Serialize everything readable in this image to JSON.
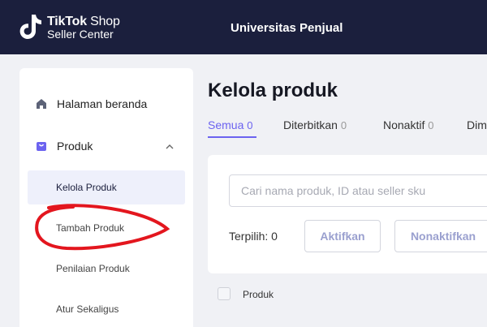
{
  "header": {
    "brand_name": "TikTok",
    "brand_suffix": "Shop",
    "brand_sub": "Seller Center",
    "nav_link": "Universitas Penjual",
    "bg_color": "#1b1f3d"
  },
  "sidebar": {
    "home_label": "Halaman beranda",
    "home_icon": "home-icon",
    "product_label": "Produk",
    "product_icon": "shopping-bag-icon",
    "product_toggle_icon": "chevron-up-icon",
    "sub_items": [
      {
        "label": "Kelola Produk",
        "active": true
      },
      {
        "label": "Tambah Produk",
        "active": false
      },
      {
        "label": "Penilaian Produk",
        "active": false
      },
      {
        "label": "Atur Sekaligus",
        "active": false
      }
    ]
  },
  "annotation": {
    "color": "#e3161e"
  },
  "main": {
    "title": "Kelola produk",
    "tabs": [
      {
        "label": "Semua",
        "count": "0",
        "active": true
      },
      {
        "label": "Diterbitkan",
        "count": "0",
        "active": false
      },
      {
        "label": "Nonaktif",
        "count": "0",
        "active": false
      },
      {
        "label": "Dim",
        "count": "",
        "active": false
      }
    ],
    "search_placeholder": "Cari nama produk, ID atau seller sku",
    "selected_label": "Terpilih: 0",
    "activate_button": "Aktifkan",
    "deactivate_button": "Nonaktifkan",
    "table_header_product": "Produk",
    "accent_color": "#6c63f0"
  }
}
